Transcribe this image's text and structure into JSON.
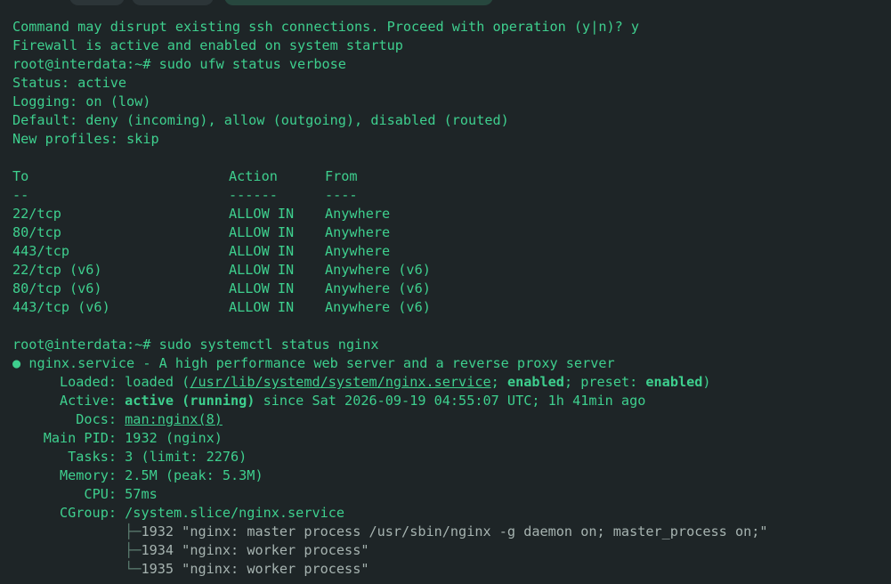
{
  "colors": {
    "background": "#1e2527",
    "text": "#3ecf8e",
    "tree_text": "#a6b3b0"
  },
  "tabs": [
    {
      "label": ""
    },
    {
      "label": ""
    },
    {
      "label": ""
    }
  ],
  "prompt": "root@interdata:~#",
  "lines": {
    "confirm": "Command may disrupt existing ssh connections. Proceed with operation (y|n)? y",
    "fw_active": "Firewall is active and enabled on system startup",
    "cmd1": "sudo ufw status verbose",
    "status": "Status: active",
    "logging": "Logging: on (low)",
    "default": "Default: deny (incoming), allow (outgoing), disabled (routed)",
    "profiles": "New profiles: skip",
    "cmd2": "sudo systemctl status nginx"
  },
  "ufw_table": {
    "headers": [
      "To",
      "Action",
      "From"
    ],
    "separators": [
      "--",
      "------",
      "----"
    ],
    "rows": [
      [
        "22/tcp",
        "ALLOW IN",
        "Anywhere"
      ],
      [
        "80/tcp",
        "ALLOW IN",
        "Anywhere"
      ],
      [
        "443/tcp",
        "ALLOW IN",
        "Anywhere"
      ],
      [
        "22/tcp (v6)",
        "ALLOW IN",
        "Anywhere (v6)"
      ],
      [
        "80/tcp (v6)",
        "ALLOW IN",
        "Anywhere (v6)"
      ],
      [
        "443/tcp (v6)",
        "ALLOW IN",
        "Anywhere (v6)"
      ]
    ]
  },
  "nginx": {
    "dot": "●",
    "title": "nginx.service - A high performance web server and a reverse proxy server",
    "loaded": {
      "label": "Loaded:",
      "pre": "loaded (",
      "path": "/usr/lib/systemd/system/nginx.service",
      "sep": "; ",
      "enabled": "enabled",
      "mid": "; preset: ",
      "preset": "enabled",
      "post": ")"
    },
    "active": {
      "label": "Active:",
      "state": "active (running)",
      "rest": " since Sat 2026-09-19 04:55:07 UTC; 1h 41min ago"
    },
    "docs": {
      "label": "Docs:",
      "value": "man:nginx(8)"
    },
    "main_pid": {
      "label": "Main PID:",
      "value": "1932 (nginx)"
    },
    "tasks": {
      "label": "Tasks:",
      "value": "3 (limit: 2276)"
    },
    "memory": {
      "label": "Memory:",
      "value": "2.5M (peak: 5.3M)"
    },
    "cpu": {
      "label": "CPU:",
      "value": "57ms"
    },
    "cgroup": {
      "label": "CGroup:",
      "value": "/system.slice/nginx.service"
    },
    "processes": [
      {
        "branch": "├─",
        "text": "1932 \"nginx: master process /usr/sbin/nginx -g daemon on; master_process on;\""
      },
      {
        "branch": "├─",
        "text": "1934 \"nginx: worker process\""
      },
      {
        "branch": "└─",
        "text": "1935 \"nginx: worker process\""
      }
    ]
  }
}
